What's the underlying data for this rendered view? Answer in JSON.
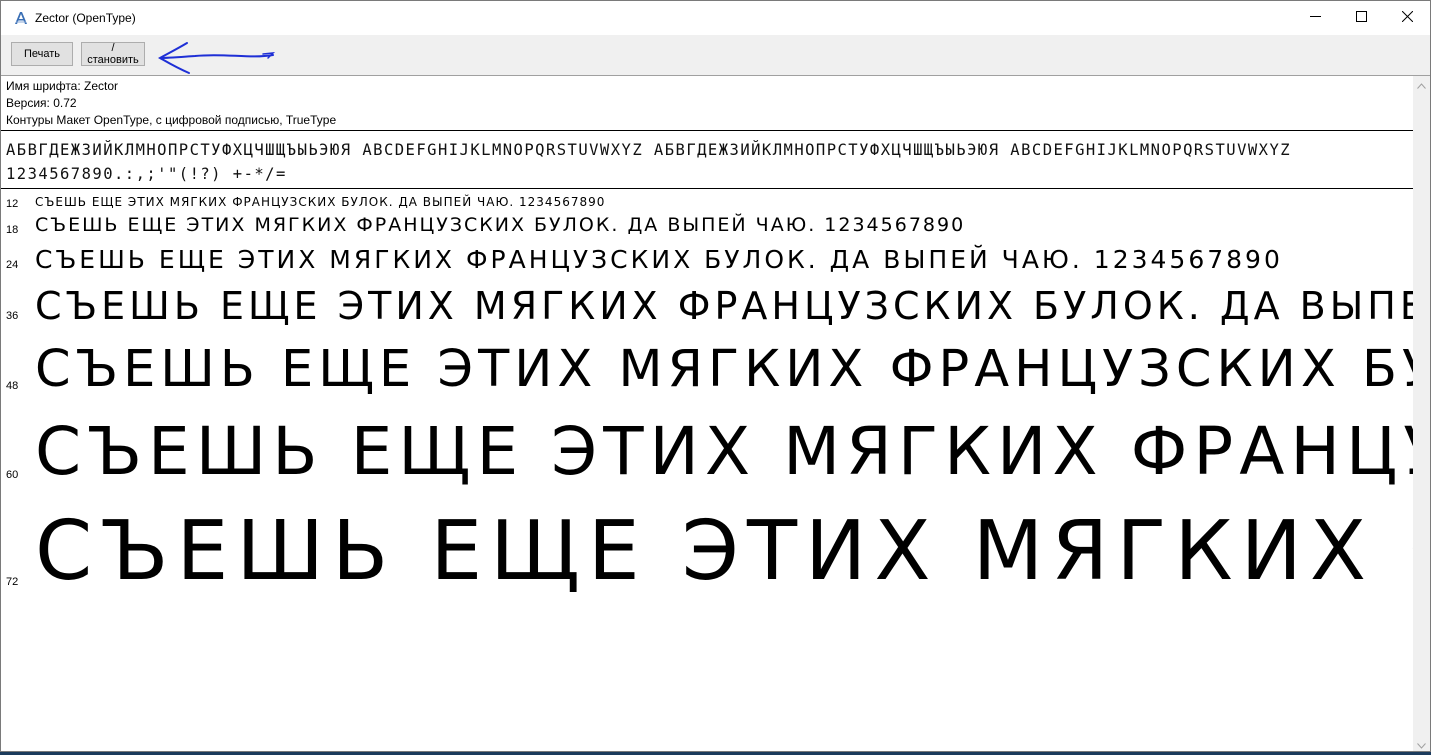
{
  "window": {
    "title": "Zector (OpenType)"
  },
  "toolbar": {
    "print_label": "Печать",
    "install_label": "/становить"
  },
  "font_info": {
    "name_line": "Имя шрифта: Zector",
    "version_line": "Версия: 0.72",
    "outline_line": "Контуры Макет OpenType, с цифровой подписью, TrueType"
  },
  "charset": {
    "line1": "АБВГДЕЖЗИЙКЛМНОПРСТУФХЦЧШЩЪЫЬЭЮЯ ABCDEFGHIJKLMNOPQRSTUVWXYZ АБВГДЕЖЗИЙКЛМНОПРСТУФХЦЧШЩЪЫЬЭЮЯ ABCDEFGHIJKLMNOPQRSTUVWXYZ",
    "line2": "1234567890.:,;'\"(!?) +-*/="
  },
  "samples": [
    {
      "size": "12",
      "text": "СЪЕШЬ ЕЩЕ ЭТИХ МЯГКИХ ФРАНЦУЗСКИХ БУЛОК. ДА ВЫПЕЙ ЧАЮ. 1234567890"
    },
    {
      "size": "18",
      "text": "СЪЕШЬ ЕЩЕ ЭТИХ МЯГКИХ ФРАНЦУЗСКИХ БУЛОК. ДА ВЫПЕЙ ЧАЮ. 1234567890"
    },
    {
      "size": "24",
      "text": "СЪЕШЬ ЕЩЕ ЭТИХ МЯГКИХ ФРАНЦУЗСКИХ БУЛОК. ДА ВЫПЕЙ ЧАЮ. 1234567890"
    },
    {
      "size": "36",
      "text": "СЪЕШЬ ЕЩЕ ЭТИХ МЯГКИХ ФРАНЦУЗСКИХ БУЛОК. ДА ВЫПЕЙ ЧАЮ."
    },
    {
      "size": "48",
      "text": "СЪЕШЬ ЕЩЕ ЭТИХ МЯГКИХ ФРАНЦУЗСКИХ БУЛОК. Д"
    },
    {
      "size": "60",
      "text": "СЪЕШЬ ЕЩЕ ЭТИХ МЯГКИХ ФРАНЦУЗСКИХ"
    },
    {
      "size": "72",
      "text": "СЪЕШЬ ЕЩЕ ЭТИХ МЯГКИХ ФРАНЦУ"
    }
  ],
  "icons": {
    "app": "font-app-icon",
    "minimize": "minimize-icon",
    "maximize": "maximize-icon",
    "close": "close-icon",
    "annotation_arrow": "arrow-left-icon"
  },
  "colors": {
    "arrow": "#1e2fd6",
    "toolbar_bg": "#f0f0f0"
  }
}
